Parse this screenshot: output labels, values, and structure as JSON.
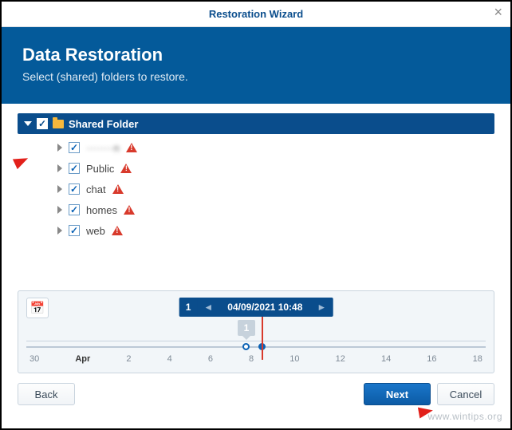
{
  "titlebar": {
    "title": "Restoration Wizard"
  },
  "banner": {
    "heading": "Data Restoration",
    "subtitle": "Select (shared) folders to restore."
  },
  "tree": {
    "root_label": "Shared Folder",
    "items": [
      {
        "label": "········n",
        "blurred": true
      },
      {
        "label": "Public",
        "blurred": false
      },
      {
        "label": "chat",
        "blurred": false
      },
      {
        "label": "homes",
        "blurred": false
      },
      {
        "label": "web",
        "blurred": false
      }
    ]
  },
  "timeline": {
    "count": "1",
    "datetime": "04/09/2021 10:48",
    "marker": "1",
    "ticks": [
      "30",
      "Apr",
      "2",
      "4",
      "6",
      "8",
      "10",
      "12",
      "14",
      "16",
      "18"
    ],
    "bold_tick_index": 1
  },
  "footer": {
    "back": "Back",
    "next": "Next",
    "cancel": "Cancel"
  },
  "watermark": "www.wintips.org"
}
